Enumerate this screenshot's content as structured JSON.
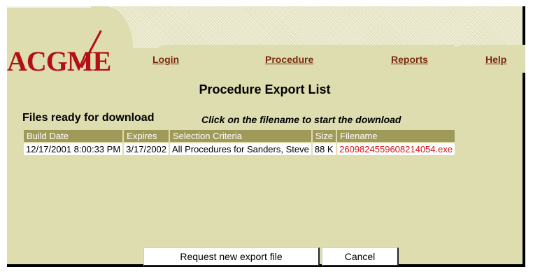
{
  "logo": {
    "text": "ACGME",
    "color": "#b30f14"
  },
  "nav": {
    "tabs": [
      {
        "label": "Login"
      },
      {
        "label": "Procedure"
      },
      {
        "label": "Reports"
      },
      {
        "label": "Help"
      }
    ]
  },
  "page": {
    "title": "Procedure Export List"
  },
  "files": {
    "label": "Files ready for download",
    "hint": "Click on the filename to start the download",
    "columns": [
      "Build Date",
      "Expires",
      "Selection Criteria",
      "Size",
      "Filename"
    ],
    "rows": [
      {
        "build_date": "12/17/2001 8:00:33 PM",
        "expires": "3/17/2002",
        "criteria": "All Procedures for Sanders, Steve",
        "size": "88 K",
        "filename": "2609824559608214054.exe"
      }
    ]
  },
  "actions": {
    "request_label": "Request new export file",
    "cancel_label": "Cancel"
  },
  "colors": {
    "background": "#deddb0",
    "header_cell": "#a09a5a",
    "link": "#7a2a10",
    "filename": "#d21414"
  }
}
